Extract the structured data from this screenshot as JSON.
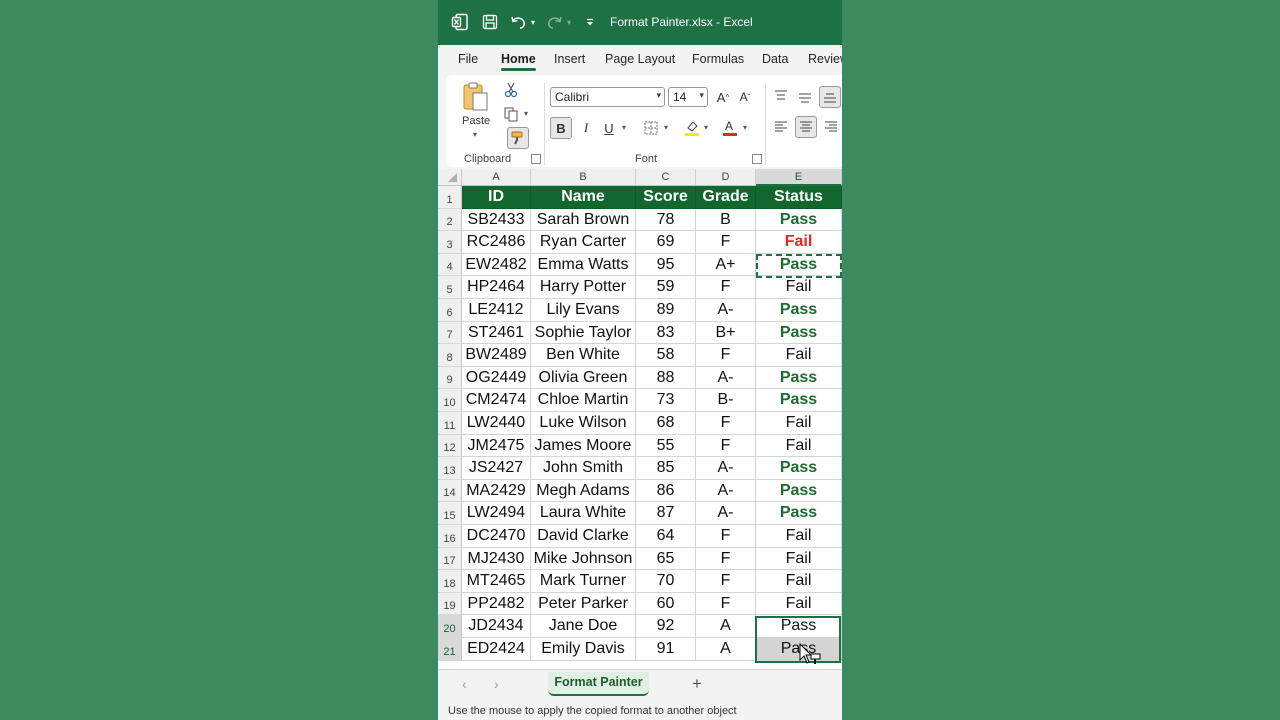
{
  "titlebar": {
    "title": "Format Painter.xlsx  -  Excel",
    "icons": [
      "excel-logo-icon",
      "save-icon",
      "undo-icon",
      "redo-icon",
      "customize-qat-icon"
    ]
  },
  "tabs": [
    "File",
    "Home",
    "Insert",
    "Page Layout",
    "Formulas",
    "Data",
    "Review"
  ],
  "active_tab": "Home",
  "ribbon": {
    "clipboard": {
      "label": "Clipboard",
      "paste_label": "Paste"
    },
    "font": {
      "label": "Font",
      "font_name": "Calibri",
      "font_size": "14"
    }
  },
  "columns": [
    "A",
    "B",
    "C",
    "D",
    "E"
  ],
  "headers": [
    "ID",
    "Name",
    "Score",
    "Grade",
    "Status"
  ],
  "rows": [
    {
      "n": "2",
      "id": "SB2433",
      "name": "Sarah Brown",
      "score": "78",
      "grade": "B",
      "status": "Pass",
      "style": "pass"
    },
    {
      "n": "3",
      "id": "RC2486",
      "name": "Ryan Carter",
      "score": "69",
      "grade": "F",
      "status": "Fail",
      "style": "fail-red"
    },
    {
      "n": "4",
      "id": "EW2482",
      "name": "Emma Watts",
      "score": "95",
      "grade": "A+",
      "status": "Pass",
      "style": "pass"
    },
    {
      "n": "5",
      "id": "HP2464",
      "name": "Harry Potter",
      "score": "59",
      "grade": "F",
      "status": "Fail",
      "style": "plain"
    },
    {
      "n": "6",
      "id": "LE2412",
      "name": "Lily Evans",
      "score": "89",
      "grade": "A-",
      "status": "Pass",
      "style": "pass"
    },
    {
      "n": "7",
      "id": "ST2461",
      "name": "Sophie Taylor",
      "score": "83",
      "grade": "B+",
      "status": "Pass",
      "style": "pass"
    },
    {
      "n": "8",
      "id": "BW2489",
      "name": "Ben White",
      "score": "58",
      "grade": "F",
      "status": "Fail",
      "style": "plain"
    },
    {
      "n": "9",
      "id": "OG2449",
      "name": "Olivia Green",
      "score": "88",
      "grade": "A-",
      "status": "Pass",
      "style": "pass"
    },
    {
      "n": "10",
      "id": "CM2474",
      "name": "Chloe Martin",
      "score": "73",
      "grade": "B-",
      "status": "Pass",
      "style": "pass"
    },
    {
      "n": "11",
      "id": "LW2440",
      "name": "Luke Wilson",
      "score": "68",
      "grade": "F",
      "status": "Fail",
      "style": "plain"
    },
    {
      "n": "12",
      "id": "JM2475",
      "name": "James Moore",
      "score": "55",
      "grade": "F",
      "status": "Fail",
      "style": "plain"
    },
    {
      "n": "13",
      "id": "JS2427",
      "name": "John Smith",
      "score": "85",
      "grade": "A-",
      "status": "Pass",
      "style": "pass"
    },
    {
      "n": "14",
      "id": "MA2429",
      "name": "Megh Adams",
      "score": "86",
      "grade": "A-",
      "status": "Pass",
      "style": "pass"
    },
    {
      "n": "15",
      "id": "LW2494",
      "name": "Laura White",
      "score": "87",
      "grade": "A-",
      "status": "Pass",
      "style": "pass"
    },
    {
      "n": "16",
      "id": "DC2470",
      "name": "David Clarke",
      "score": "64",
      "grade": "F",
      "status": "Fail",
      "style": "plain"
    },
    {
      "n": "17",
      "id": "MJ2430",
      "name": "Mike Johnson",
      "score": "65",
      "grade": "F",
      "status": "Fail",
      "style": "plain"
    },
    {
      "n": "18",
      "id": "MT2465",
      "name": "Mark Turner",
      "score": "70",
      "grade": "F",
      "status": "Fail",
      "style": "plain"
    },
    {
      "n": "19",
      "id": "PP2482",
      "name": "Peter Parker",
      "score": "60",
      "grade": "F",
      "status": "Fail",
      "style": "plain"
    },
    {
      "n": "20",
      "id": "JD2434",
      "name": "Jane Doe",
      "score": "92",
      "grade": "A",
      "status": "Pass",
      "style": "plain"
    },
    {
      "n": "21",
      "id": "ED2424",
      "name": "Emily Davis",
      "score": "91",
      "grade": "A",
      "status": "Pass",
      "style": "plain"
    }
  ],
  "sheet_tab": "Format Painter",
  "status_text": "Use the mouse to apply the copied format to another object",
  "colors": {
    "excel_green": "#1e7145",
    "header_fill": "#12672f",
    "pass_text": "#1d6b2e",
    "fail_text": "#e02a1f",
    "page_background": "#3d8a5e"
  }
}
